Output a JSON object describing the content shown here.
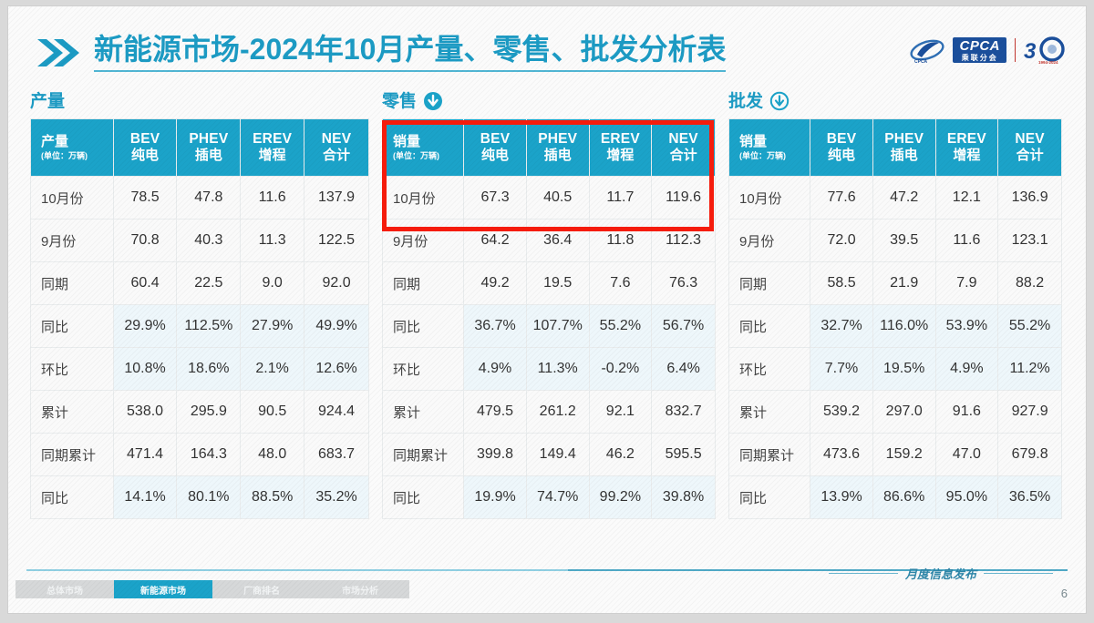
{
  "slide": {
    "title": "新能源市场-2024年10月产量、零售、批发分析表",
    "title_accent_color": "#1c9bc4",
    "page_number": "6",
    "footer_brand": "月度信息发布",
    "highlight_color": "#f51c0c"
  },
  "logo": {
    "english": "CPCA",
    "chinese": "乘联分会",
    "anniversary": "30",
    "anniversary_sub": "1994-2024"
  },
  "tabs": [
    {
      "label": "总体市场",
      "active": false
    },
    {
      "label": "新能源市场",
      "active": true
    },
    {
      "label": "厂商排名",
      "active": false
    },
    {
      "label": "市场分析",
      "active": false
    }
  ],
  "columns": [
    {
      "en": "BEV",
      "cn": "纯电"
    },
    {
      "en": "PHEV",
      "cn": "插电"
    },
    {
      "en": "EREV",
      "cn": "增程"
    },
    {
      "en": "NEV",
      "cn": "合计"
    }
  ],
  "unit_label": "(单位：万辆)",
  "row_labels": [
    "10月份",
    "9月份",
    "同期",
    "同比",
    "环比",
    "累计",
    "同期累计",
    "同比"
  ],
  "panels": [
    {
      "section_title": "产量",
      "icon": "none",
      "corner_label": "产量",
      "highlighted": false,
      "rows": [
        {
          "label": "10月份",
          "pct": false,
          "values": [
            "78.5",
            "47.8",
            "11.6",
            "137.9"
          ]
        },
        {
          "label": "9月份",
          "pct": false,
          "values": [
            "70.8",
            "40.3",
            "11.3",
            "122.5"
          ]
        },
        {
          "label": "同期",
          "pct": false,
          "values": [
            "60.4",
            "22.5",
            "9.0",
            "92.0"
          ]
        },
        {
          "label": "同比",
          "pct": true,
          "values": [
            "29.9%",
            "112.5%",
            "27.9%",
            "49.9%"
          ]
        },
        {
          "label": "环比",
          "pct": true,
          "values": [
            "10.8%",
            "18.6%",
            "2.1%",
            "12.6%"
          ]
        },
        {
          "label": "累计",
          "pct": false,
          "values": [
            "538.0",
            "295.9",
            "90.5",
            "924.4"
          ]
        },
        {
          "label": "同期累计",
          "pct": false,
          "values": [
            "471.4",
            "164.3",
            "48.0",
            "683.7"
          ]
        },
        {
          "label": "同比",
          "pct": true,
          "values": [
            "14.1%",
            "80.1%",
            "88.5%",
            "35.2%"
          ]
        }
      ]
    },
    {
      "section_title": "零售",
      "icon": "down-arrow-filled-circle-icon",
      "corner_label": "销量",
      "highlighted": true,
      "rows": [
        {
          "label": "10月份",
          "pct": false,
          "values": [
            "67.3",
            "40.5",
            "11.7",
            "119.6"
          ]
        },
        {
          "label": "9月份",
          "pct": false,
          "values": [
            "64.2",
            "36.4",
            "11.8",
            "112.3"
          ]
        },
        {
          "label": "同期",
          "pct": false,
          "values": [
            "49.2",
            "19.5",
            "7.6",
            "76.3"
          ]
        },
        {
          "label": "同比",
          "pct": true,
          "values": [
            "36.7%",
            "107.7%",
            "55.2%",
            "56.7%"
          ]
        },
        {
          "label": "环比",
          "pct": true,
          "values": [
            "4.9%",
            "11.3%",
            "-0.2%",
            "6.4%"
          ]
        },
        {
          "label": "累计",
          "pct": false,
          "values": [
            "479.5",
            "261.2",
            "92.1",
            "832.7"
          ]
        },
        {
          "label": "同期累计",
          "pct": false,
          "values": [
            "399.8",
            "149.4",
            "46.2",
            "595.5"
          ]
        },
        {
          "label": "同比",
          "pct": true,
          "values": [
            "19.9%",
            "74.7%",
            "99.2%",
            "39.8%"
          ]
        }
      ]
    },
    {
      "section_title": "批发",
      "icon": "down-arrow-outline-circle-icon",
      "corner_label": "销量",
      "highlighted": false,
      "rows": [
        {
          "label": "10月份",
          "pct": false,
          "values": [
            "77.6",
            "47.2",
            "12.1",
            "136.9"
          ]
        },
        {
          "label": "9月份",
          "pct": false,
          "values": [
            "72.0",
            "39.5",
            "11.6",
            "123.1"
          ]
        },
        {
          "label": "同期",
          "pct": false,
          "values": [
            "58.5",
            "21.9",
            "7.9",
            "88.2"
          ]
        },
        {
          "label": "同比",
          "pct": true,
          "values": [
            "32.7%",
            "116.0%",
            "53.9%",
            "55.2%"
          ]
        },
        {
          "label": "环比",
          "pct": true,
          "values": [
            "7.7%",
            "19.5%",
            "4.9%",
            "11.2%"
          ]
        },
        {
          "label": "累计",
          "pct": false,
          "values": [
            "539.2",
            "297.0",
            "91.6",
            "927.9"
          ]
        },
        {
          "label": "同期累计",
          "pct": false,
          "values": [
            "473.6",
            "159.2",
            "47.0",
            "679.8"
          ]
        },
        {
          "label": "同比",
          "pct": true,
          "values": [
            "13.9%",
            "86.6%",
            "95.0%",
            "36.5%"
          ]
        }
      ]
    }
  ],
  "chart_data": {
    "type": "table",
    "title": "新能源市场-2024年10月产量、零售、批发分析表",
    "unit": "万辆",
    "categories": [
      "BEV 纯电",
      "PHEV 插电",
      "EREV 增程",
      "NEV 合计"
    ],
    "tables": [
      {
        "name": "产量",
        "row_labels": [
          "10月份",
          "9月份",
          "同期",
          "同比",
          "环比",
          "累计",
          "同期累计",
          "同比"
        ],
        "series": [
          {
            "name": "10月份",
            "values": [
              78.5,
              47.8,
              11.6,
              137.9
            ]
          },
          {
            "name": "9月份",
            "values": [
              70.8,
              40.3,
              11.3,
              122.5
            ]
          },
          {
            "name": "同期",
            "values": [
              60.4,
              22.5,
              9.0,
              92.0
            ]
          },
          {
            "name": "同比",
            "values": [
              29.9,
              112.5,
              27.9,
              49.9
            ],
            "unit": "%"
          },
          {
            "name": "环比",
            "values": [
              10.8,
              18.6,
              2.1,
              12.6
            ],
            "unit": "%"
          },
          {
            "name": "累计",
            "values": [
              538.0,
              295.9,
              90.5,
              924.4
            ]
          },
          {
            "name": "同期累计",
            "values": [
              471.4,
              164.3,
              48.0,
              683.7
            ]
          },
          {
            "name": "同比(累计)",
            "values": [
              14.1,
              80.1,
              88.5,
              35.2
            ],
            "unit": "%"
          }
        ]
      },
      {
        "name": "零售",
        "row_labels": [
          "10月份",
          "9月份",
          "同期",
          "同比",
          "环比",
          "累计",
          "同期累计",
          "同比"
        ],
        "series": [
          {
            "name": "10月份",
            "values": [
              67.3,
              40.5,
              11.7,
              119.6
            ]
          },
          {
            "name": "9月份",
            "values": [
              64.2,
              36.4,
              11.8,
              112.3
            ]
          },
          {
            "name": "同期",
            "values": [
              49.2,
              19.5,
              7.6,
              76.3
            ]
          },
          {
            "name": "同比",
            "values": [
              36.7,
              107.7,
              55.2,
              56.7
            ],
            "unit": "%"
          },
          {
            "name": "环比",
            "values": [
              4.9,
              11.3,
              -0.2,
              6.4
            ],
            "unit": "%"
          },
          {
            "name": "累计",
            "values": [
              479.5,
              261.2,
              92.1,
              832.7
            ]
          },
          {
            "name": "同期累计",
            "values": [
              399.8,
              149.4,
              46.2,
              595.5
            ]
          },
          {
            "name": "同比(累计)",
            "values": [
              19.9,
              74.7,
              99.2,
              39.8
            ],
            "unit": "%"
          }
        ]
      },
      {
        "name": "批发",
        "row_labels": [
          "10月份",
          "9月份",
          "同期",
          "同比",
          "环比",
          "累计",
          "同期累计",
          "同比"
        ],
        "series": [
          {
            "name": "10月份",
            "values": [
              77.6,
              47.2,
              12.1,
              136.9
            ]
          },
          {
            "name": "9月份",
            "values": [
              72.0,
              39.5,
              11.6,
              123.1
            ]
          },
          {
            "name": "同期",
            "values": [
              58.5,
              21.9,
              7.9,
              88.2
            ]
          },
          {
            "name": "同比",
            "values": [
              32.7,
              116.0,
              53.9,
              55.2
            ],
            "unit": "%"
          },
          {
            "name": "环比",
            "values": [
              7.7,
              19.5,
              4.9,
              11.2
            ],
            "unit": "%"
          },
          {
            "name": "累计",
            "values": [
              539.2,
              297.0,
              91.6,
              927.9
            ]
          },
          {
            "name": "同期累计",
            "values": [
              473.6,
              159.2,
              47.0,
              679.8
            ]
          },
          {
            "name": "同比(累计)",
            "values": [
              13.9,
              86.6,
              95.0,
              36.5
            ],
            "unit": "%"
          }
        ]
      }
    ]
  }
}
